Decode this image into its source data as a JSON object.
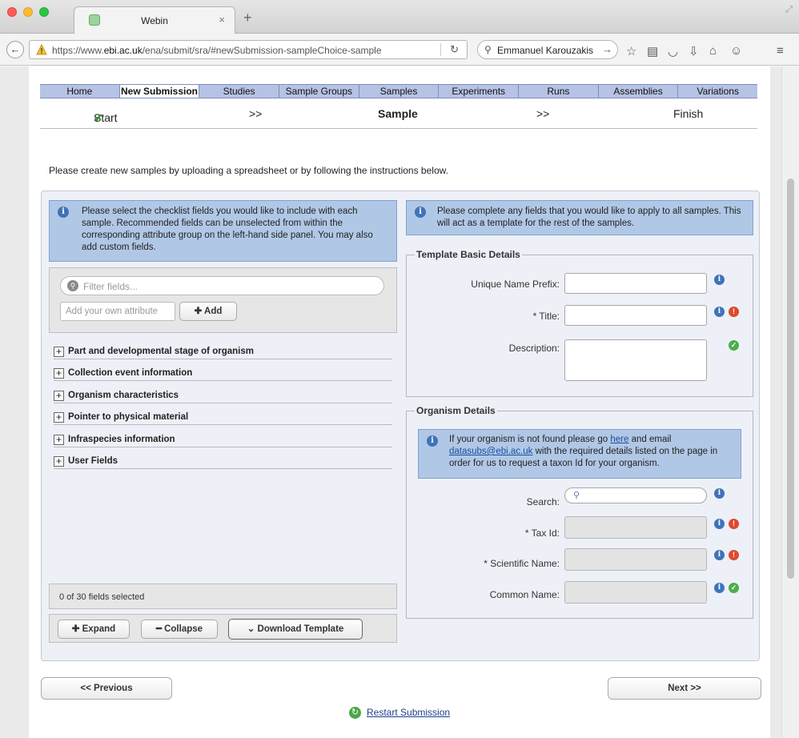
{
  "browser": {
    "tab_title": "Webin",
    "tab_close": "×",
    "new_tab": "+",
    "url_host_prefix": "https://www.",
    "url_host": "ebi.ac.uk",
    "url_path": "/ena/submit/sra/#newSubmission-sampleChoice-sample",
    "search_text": "Emmanuel Karouzakis"
  },
  "site_nav": {
    "items": [
      "Home",
      "New Submission",
      "Studies",
      "Sample Groups",
      "Samples",
      "Experiments",
      "Runs",
      "Assemblies",
      "Variations"
    ],
    "active": "New Submission"
  },
  "steps": {
    "start": "Start",
    "sep1": ">>",
    "current": "Sample",
    "sep2": ">>",
    "finish": "Finish"
  },
  "intro_text": "Please create new samples by uploading a spreadsheet or by following the instructions below.",
  "left_panel": {
    "info_text": "Please select the checklist fields you would like to include with each sample. Recommended fields can be unselected from within the corresponding attribute group on the left-hand side panel. You may also add custom fields.",
    "filter_placeholder": "Filter fields...",
    "attribute_placeholder": "Add your own attribute",
    "add_label": "Add",
    "groups": [
      "Part and developmental stage of organism",
      "Collection event information",
      "Organism characteristics",
      "Pointer to physical material",
      "Infraspecies information",
      "User Fields"
    ],
    "count_text": "0 of 30 fields selected",
    "expand_label": "Expand",
    "collapse_label": "Collapse",
    "download_label": "Download Template"
  },
  "right_panel": {
    "info_text": "Please complete any fields that you would like to apply to all samples. This will act as a template for the rest of the samples.",
    "template_legend": "Template Basic Details",
    "unique_name_label": "Unique Name Prefix:",
    "title_label": "* Title:",
    "description_label": "Description:",
    "organism_legend": "Organism Details",
    "organism_info_prefix": "If your organism is not found please go",
    "organism_info_here": "here",
    "organism_info_mid": "and email",
    "organism_info_email": "datasubs@ebi.ac.uk",
    "organism_info_suffix": "with the required details listed on the page in order for us to request a taxon Id for your organism.",
    "search_label": "Search:",
    "tax_id_label": "* Tax Id:",
    "scientific_name_label": "* Scientific Name:",
    "common_name_label": "Common Name:"
  },
  "footer": {
    "previous_label": "<< Previous",
    "next_label": "Next >>",
    "restart_label": "Restart Submission"
  },
  "colors": {
    "nav_bg": "#b7c3e4",
    "info_bg": "#b0c8e6",
    "panel_bg": "#eef0f7",
    "ok": "#4cae4c",
    "error": "#e0492f"
  }
}
